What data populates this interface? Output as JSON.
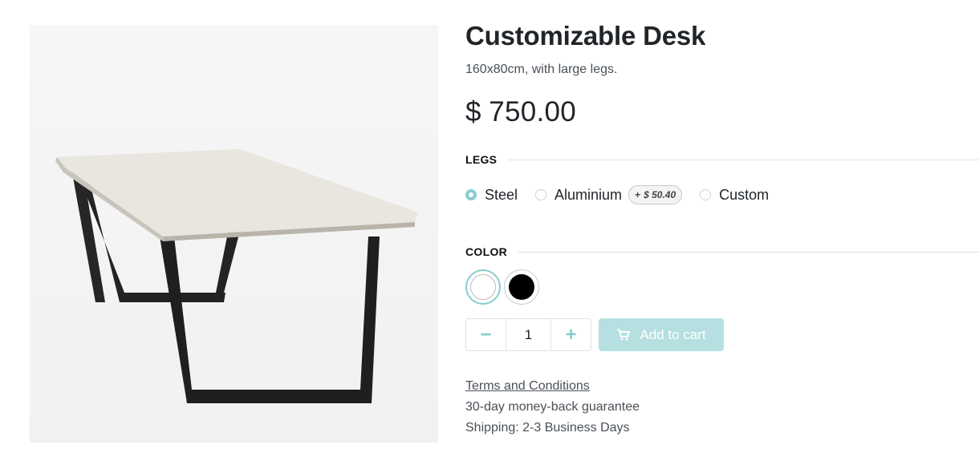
{
  "product": {
    "name": "Customizable Desk",
    "description": "160x80cm, with large legs.",
    "currency": "$",
    "price": "750.00"
  },
  "legs": {
    "label": "LEGS",
    "options": [
      {
        "label": "Steel",
        "selected": true
      },
      {
        "label": "Aluminium",
        "selected": false,
        "extra_sign": "+",
        "extra": "$ 50.40"
      },
      {
        "label": "Custom",
        "selected": false
      }
    ]
  },
  "color": {
    "label": "COLOR",
    "swatches": [
      {
        "name": "White",
        "hex": "#ffffff",
        "selected": true
      },
      {
        "name": "Black",
        "hex": "#000000",
        "selected": false
      }
    ]
  },
  "cart": {
    "quantity": "1",
    "minus": "−",
    "plus": "+",
    "add_label": "Add to cart"
  },
  "info": {
    "terms": "Terms and Conditions",
    "guarantee": "30-day money-back guarantee",
    "shipping": "Shipping: 2-3 Business Days"
  },
  "colors": {
    "accent": "#88cccf",
    "button_bg": "#b5dfe0"
  },
  "icons": {
    "cart": "shopping-cart-icon",
    "minus": "minus-icon",
    "plus": "plus-icon"
  }
}
